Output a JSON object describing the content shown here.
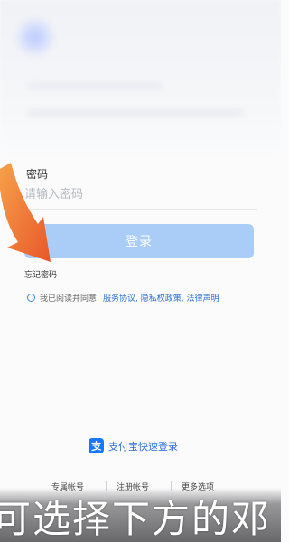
{
  "password_field": {
    "label": "密码",
    "placeholder": "请输入密码"
  },
  "login_button": {
    "label": "登录"
  },
  "forgot_password": {
    "label": "忘记密码"
  },
  "agreement": {
    "prefix": "我已阅读并同意:",
    "links": "服务协议, 隐私权政策, 法律声明"
  },
  "alipay_login": {
    "label": "支付宝快速登录"
  },
  "bottom_links": {
    "exclusive_account": "专属帐号",
    "register": "注册帐号",
    "more_options": "更多选项"
  },
  "subtitle": {
    "text": "可选择下方的邓"
  },
  "colors": {
    "accent": "#1677ff",
    "button_bg": "#a9cdf6",
    "link": "#2a6fd6",
    "arrow": "#f07a22"
  }
}
